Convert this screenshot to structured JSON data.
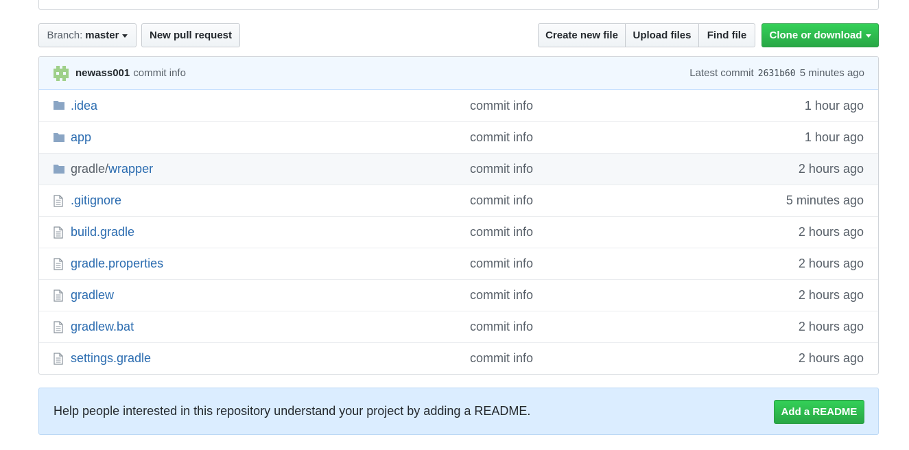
{
  "toolbar": {
    "branch_label": "Branch:",
    "branch_value": "master",
    "new_pr_label": "New pull request",
    "create_file_label": "Create new file",
    "upload_files_label": "Upload files",
    "find_file_label": "Find file",
    "clone_label": "Clone or download"
  },
  "commit": {
    "author": "newass001",
    "message": "commit info",
    "latest_label": "Latest commit",
    "sha": "2631b60",
    "age": "5 minutes ago"
  },
  "files": [
    {
      "type": "folder",
      "name": ".idea",
      "commit": "commit info",
      "age": "1 hour ago"
    },
    {
      "type": "folder",
      "name": "app",
      "commit": "commit info",
      "age": "1 hour ago"
    },
    {
      "type": "folder",
      "name_prefix": "gradle/",
      "name": "wrapper",
      "commit": "commit info",
      "age": "2 hours ago"
    },
    {
      "type": "file",
      "name": ".gitignore",
      "commit": "commit info",
      "age": "5 minutes ago"
    },
    {
      "type": "file",
      "name": "build.gradle",
      "commit": "commit info",
      "age": "2 hours ago"
    },
    {
      "type": "file",
      "name": "gradle.properties",
      "commit": "commit info",
      "age": "2 hours ago"
    },
    {
      "type": "file",
      "name": "gradlew",
      "commit": "commit info",
      "age": "2 hours ago"
    },
    {
      "type": "file",
      "name": "gradlew.bat",
      "commit": "commit info",
      "age": "2 hours ago"
    },
    {
      "type": "file",
      "name": "settings.gradle",
      "commit": "commit info",
      "age": "2 hours ago"
    }
  ],
  "readme": {
    "text": "Help people interested in this repository understand your project by adding a README.",
    "button_label": "Add a README"
  },
  "colors": {
    "link": "#2b6cb0",
    "green": "#28a745",
    "commit_bar_bg": "#f1f8ff",
    "readme_bg": "#dbedff",
    "folder_icon": "#79b8ff"
  }
}
